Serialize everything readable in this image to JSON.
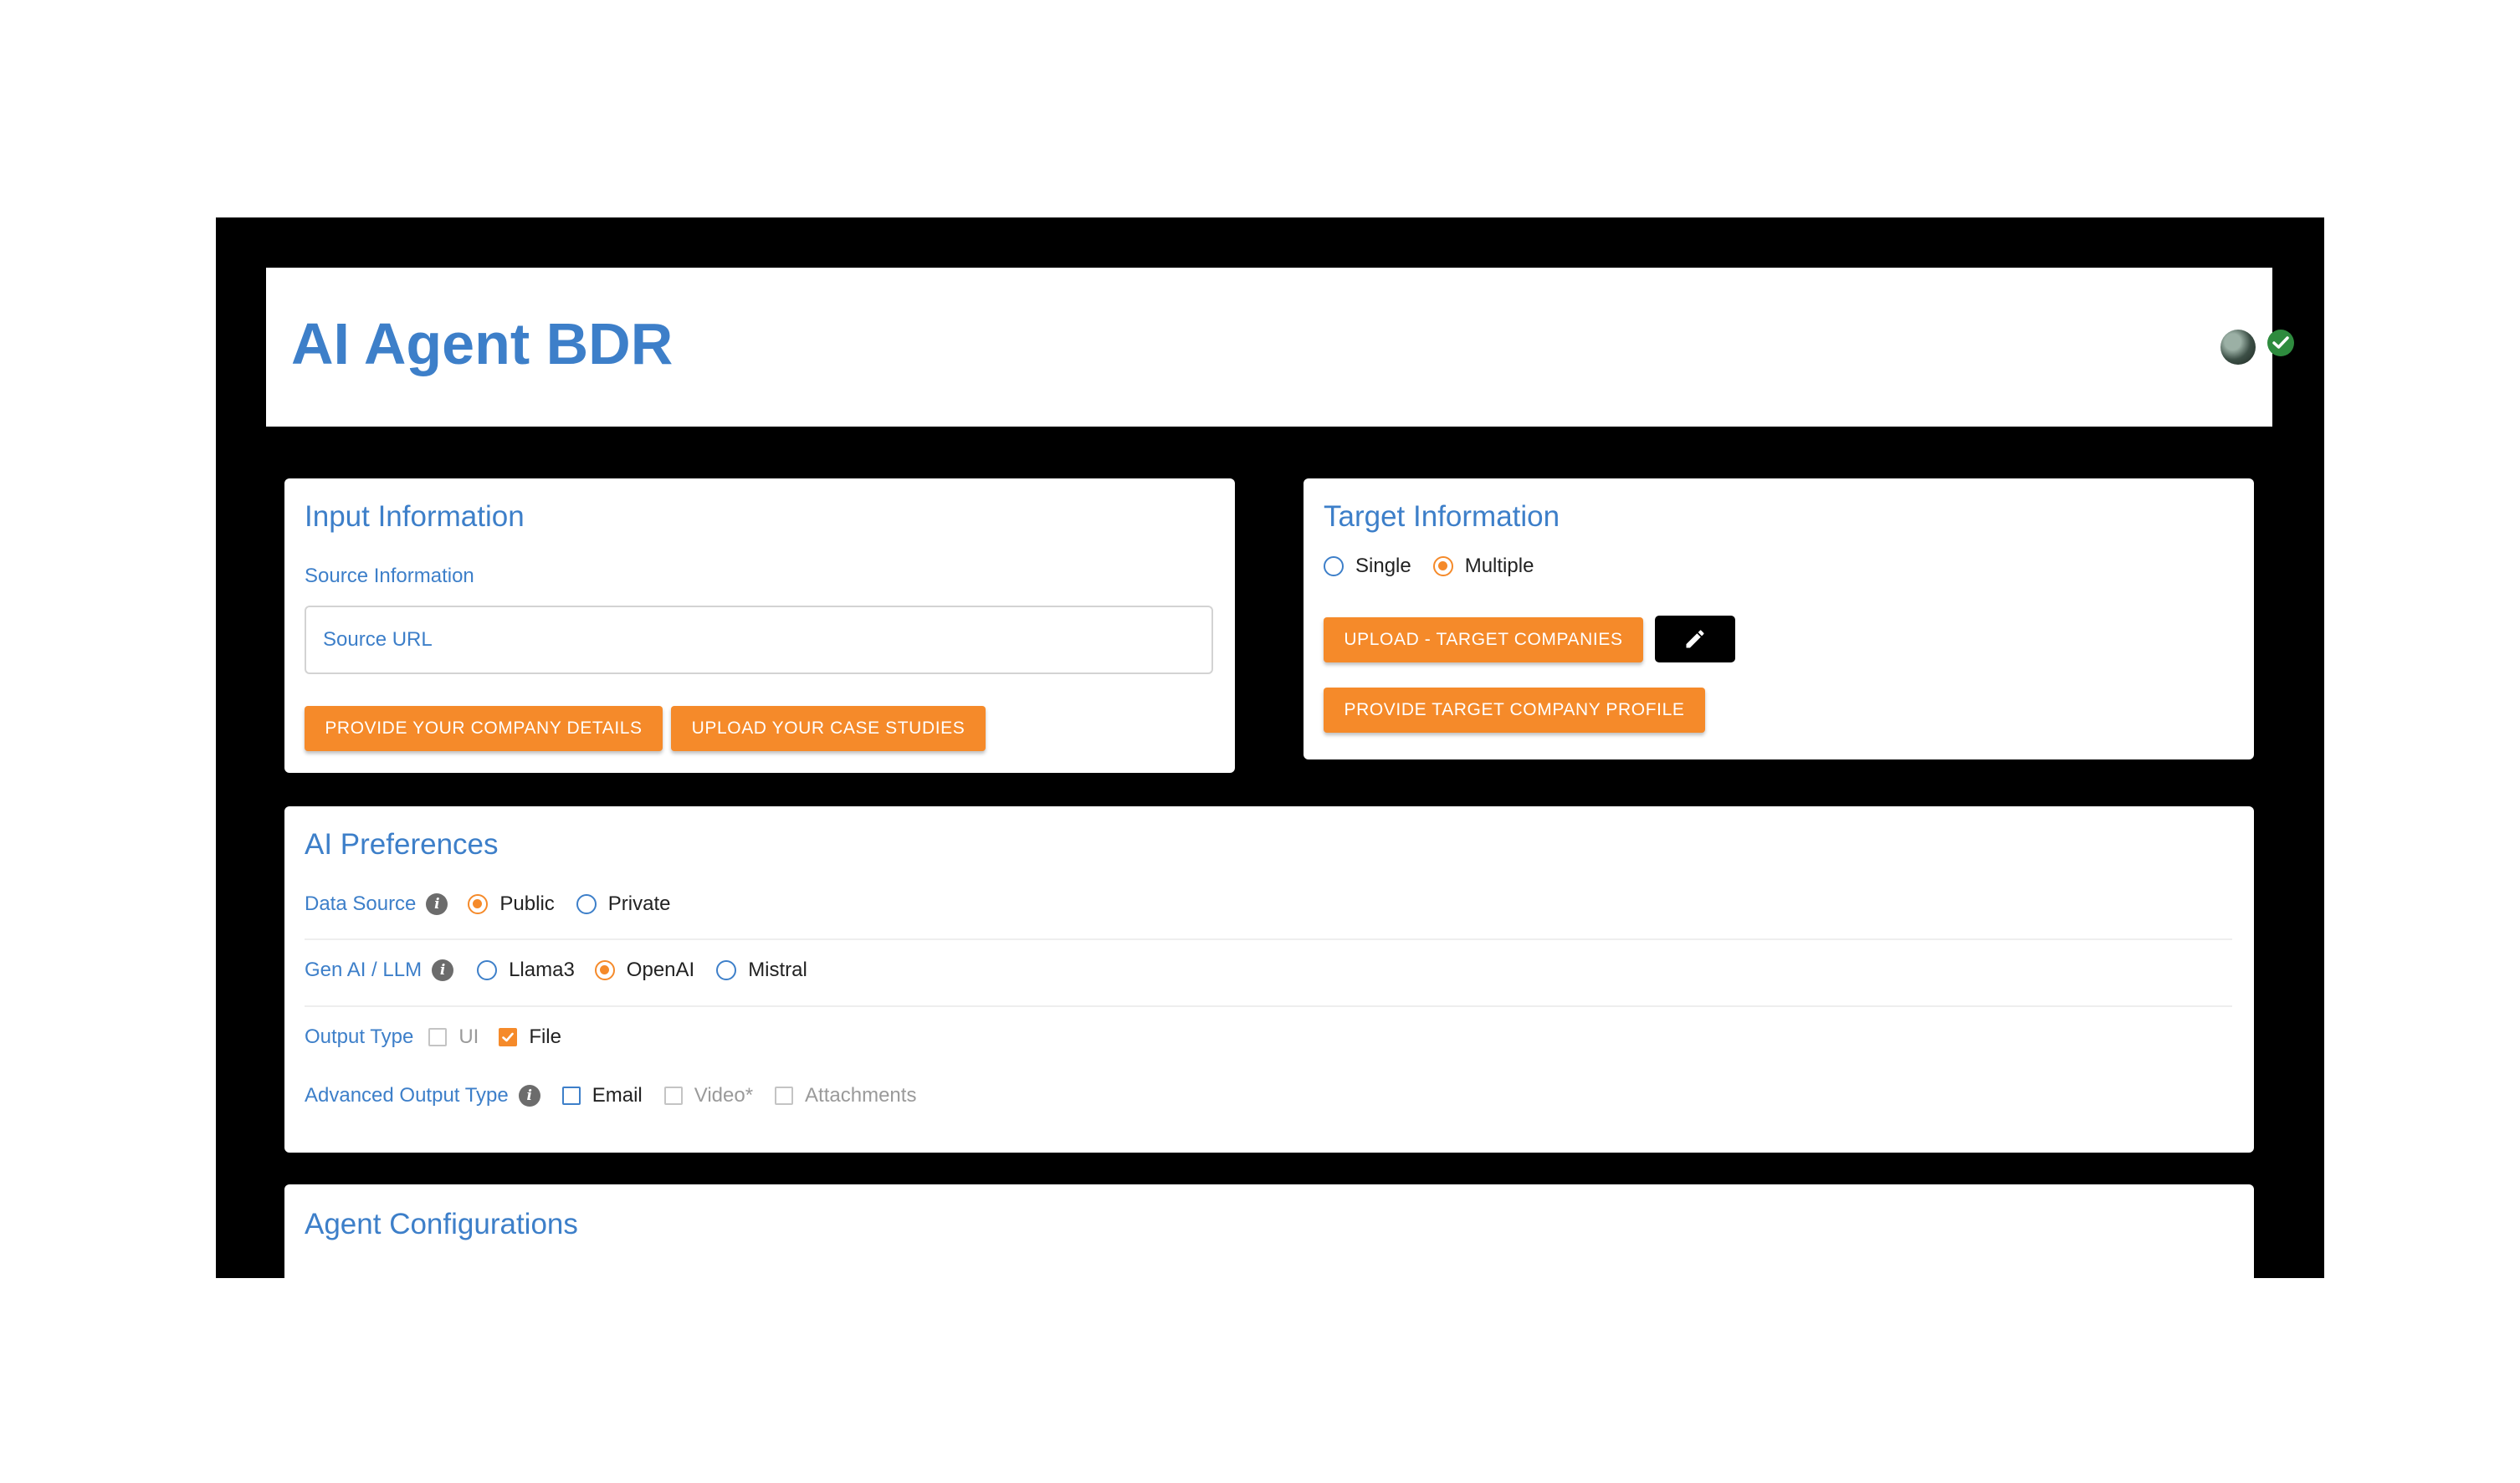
{
  "app": {
    "title": "AI Agent BDR"
  },
  "header": {
    "avatar_icon": "user-avatar-icon",
    "status_icon": "check-circle-icon",
    "status_color": "#2e8b3e"
  },
  "colors": {
    "accent": "#f58a2a",
    "title_blue": "#3d7fc9",
    "frame": "#000000"
  },
  "input_info": {
    "title": "Input Information",
    "source_label": "Source Information",
    "source_url_placeholder": "Source URL",
    "source_url_value": "",
    "buttons": {
      "company_details": "PROVIDE YOUR COMPANY DETAILS",
      "case_studies": "UPLOAD YOUR CASE STUDIES"
    }
  },
  "target_info": {
    "title": "Target Information",
    "mode_options": [
      {
        "label": "Single",
        "selected": false
      },
      {
        "label": "Multiple",
        "selected": true
      }
    ],
    "buttons": {
      "upload_targets": "UPLOAD - TARGET COMPANIES",
      "edit_icon": "pencil-icon",
      "target_profile": "PROVIDE TARGET COMPANY PROFILE"
    }
  },
  "ai_prefs": {
    "title": "AI Preferences",
    "data_source": {
      "label": "Data Source",
      "options": [
        {
          "label": "Public",
          "selected": true
        },
        {
          "label": "Private",
          "selected": false
        }
      ]
    },
    "gen_ai": {
      "label": "Gen AI / LLM",
      "options": [
        {
          "label": "Llama3",
          "selected": false
        },
        {
          "label": "OpenAI",
          "selected": true
        },
        {
          "label": "Mistral",
          "selected": false
        }
      ]
    },
    "output_type": {
      "label": "Output Type",
      "options": [
        {
          "label": "UI",
          "checked": false,
          "disabled": true
        },
        {
          "label": "File",
          "checked": true,
          "disabled": false
        }
      ]
    },
    "advanced_output": {
      "label": "Advanced Output Type",
      "options": [
        {
          "label": "Email",
          "checked": false,
          "disabled": false
        },
        {
          "label": "Video*",
          "checked": false,
          "disabled": true
        },
        {
          "label": "Attachments",
          "checked": false,
          "disabled": true
        }
      ]
    }
  },
  "agent_config": {
    "title": "Agent Configurations"
  }
}
